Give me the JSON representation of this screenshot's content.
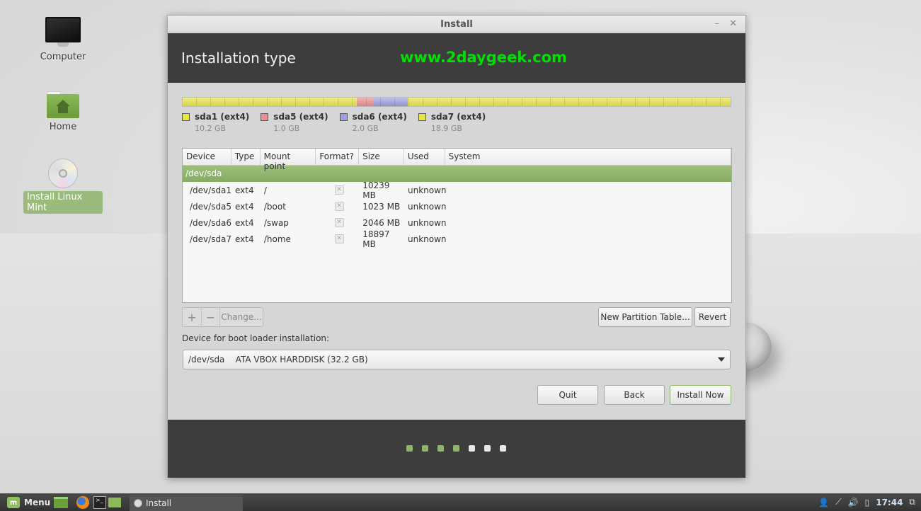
{
  "desktop": {
    "icons": [
      {
        "label": "Computer",
        "icon": "computer-icon"
      },
      {
        "label": "Home",
        "icon": "home-folder-icon"
      },
      {
        "label": "Install Linux Mint",
        "icon": "cd-icon",
        "selected": true
      }
    ]
  },
  "window": {
    "title": "Install",
    "minimize": "–",
    "close": "✕",
    "header_title": "Installation type",
    "watermark": "www.2daygeek.com"
  },
  "partition_bar": {
    "segments": [
      {
        "name": "sda1 (ext4)",
        "size": "10.2 GB",
        "gb": 10.2,
        "color": "#e6e64a"
      },
      {
        "name": "sda5 (ext4)",
        "size": "1.0 GB",
        "gb": 1.0,
        "color": "#e89090"
      },
      {
        "name": "sda6 (ext4)",
        "size": "2.0 GB",
        "gb": 2.0,
        "color": "#9aa0e0"
      },
      {
        "name": "sda7 (ext4)",
        "size": "18.9 GB",
        "gb": 18.9,
        "color": "#e6e64a"
      }
    ]
  },
  "table": {
    "columns": [
      "Device",
      "Type",
      "Mount point",
      "Format?",
      "Size",
      "Used",
      "System"
    ],
    "group": "/dev/sda",
    "rows": [
      {
        "device": "/dev/sda1",
        "type": "ext4",
        "mount": "/",
        "format": false,
        "size": "10239 MB",
        "used": "unknown",
        "system": ""
      },
      {
        "device": "/dev/sda5",
        "type": "ext4",
        "mount": "/boot",
        "format": false,
        "size": "1023 MB",
        "used": "unknown",
        "system": ""
      },
      {
        "device": "/dev/sda6",
        "type": "ext4",
        "mount": "/swap",
        "format": false,
        "size": "2046 MB",
        "used": "unknown",
        "system": ""
      },
      {
        "device": "/dev/sda7",
        "type": "ext4",
        "mount": "/home",
        "format": false,
        "size": "18897 MB",
        "used": "unknown",
        "system": ""
      }
    ]
  },
  "toolbar": {
    "add": "+",
    "remove": "−",
    "change": "Change...",
    "new_partition_table": "New Partition Table...",
    "revert": "Revert"
  },
  "bootloader": {
    "label": "Device for boot loader installation:",
    "value": "/dev/sda    ATA VBOX HARDDISK (32.2 GB)"
  },
  "buttons": {
    "quit": "Quit",
    "back": "Back",
    "install_now": "Install Now"
  },
  "progress": {
    "total_steps": 7,
    "completed_steps": 4,
    "done_color": "#8fb56a",
    "todo_color": "#e8e8e8"
  },
  "taskbar": {
    "menu_label": "Menu",
    "launchers": [
      "show-desktop-icon",
      "firefox-icon",
      "terminal-icon",
      "files-icon"
    ],
    "window_label": "Install",
    "clock": "17:44"
  }
}
